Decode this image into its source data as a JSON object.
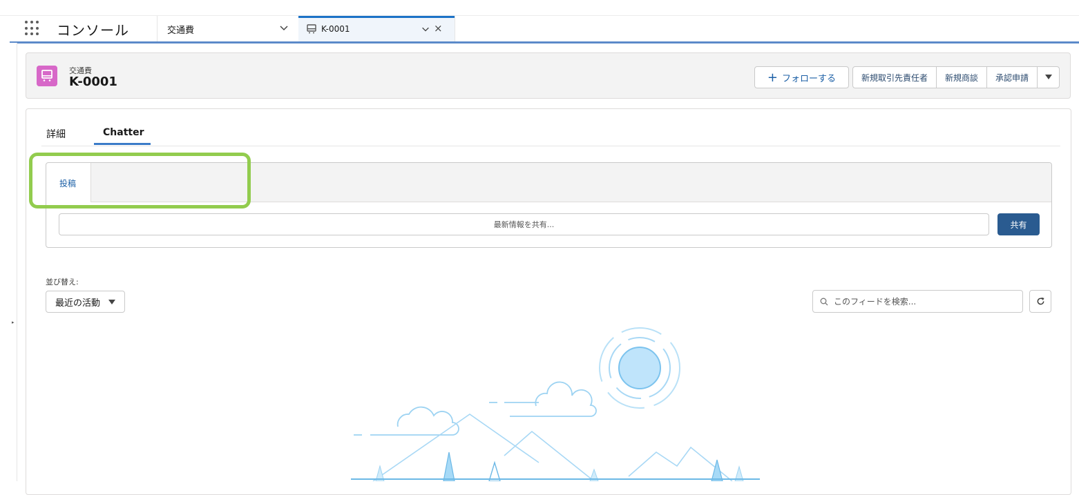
{
  "nav": {
    "app_name": "コンソール",
    "object_item": "交通費",
    "active_tab": {
      "label": "K-0001",
      "icon": "record-icon"
    }
  },
  "record": {
    "object_label": "交通費",
    "name": "K-0001",
    "icon_color": "#d768c8",
    "actions": {
      "follow": "フォローする",
      "new_contact": "新規取引先責任者",
      "new_opportunity": "新規商談",
      "approval_request": "承認申請"
    }
  },
  "tabs": {
    "details": "詳細",
    "chatter": "Chatter"
  },
  "publisher": {
    "tab_post": "投稿",
    "placeholder": "最新情報を共有...",
    "share_button": "共有"
  },
  "feed": {
    "sort_label": "並び替え:",
    "sort_value": "最近の活動",
    "search_placeholder": "このフィードを検索..."
  },
  "colors": {
    "accent": "#1b72c7",
    "highlight": "#92cc4e",
    "share_button": "#2a5b90"
  }
}
